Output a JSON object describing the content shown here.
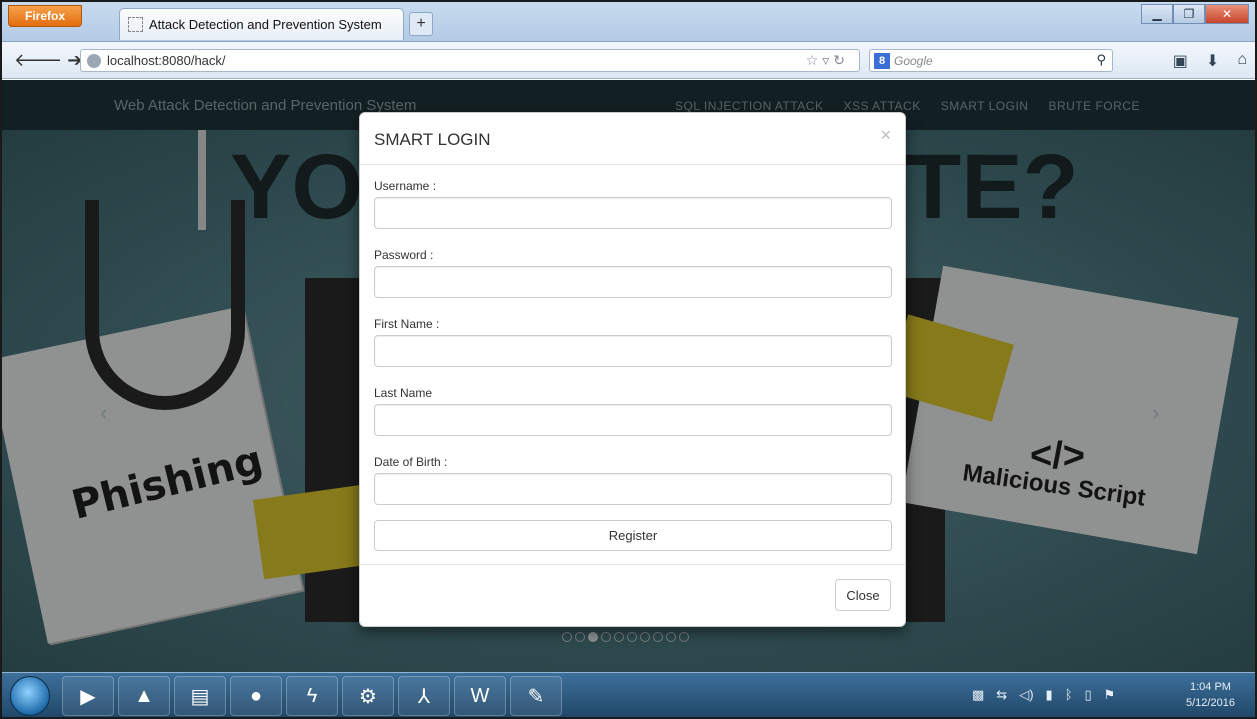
{
  "browser": {
    "firefox_button": "Firefox",
    "tab_title": "Attack Detection and Prevention System",
    "new_tab": "+",
    "url": "localhost:8080/hack/",
    "search_engine": "8",
    "search_placeholder": "Google"
  },
  "site": {
    "brand": "Web Attack Detection and Prevention System",
    "menu": [
      "SQL INJECTION ATTACK",
      "XSS ATTACK",
      "SMART LOGIN",
      "BRUTE FORCE"
    ]
  },
  "hero": {
    "letters_left": "YO",
    "letters_right": "TE?",
    "left_word": "Phishing",
    "right_tag": "</>",
    "right_word": "Malicious Script",
    "slides_total": 10,
    "slide_active": 3
  },
  "modal": {
    "title": "SMART LOGIN",
    "close_x": "×",
    "fields": [
      {
        "label": "Username :",
        "value": ""
      },
      {
        "label": "Password :",
        "value": ""
      },
      {
        "label": "First Name :",
        "value": ""
      },
      {
        "label": "Last Name",
        "value": ""
      },
      {
        "label": "Date of Birth :",
        "value": ""
      }
    ],
    "register_label": "Register",
    "close_label": "Close"
  },
  "taskbar": {
    "time": "1:04 PM",
    "date": "5/12/2016"
  },
  "colors": {
    "site_nav": "#1f3439",
    "hero": "#4f7d84",
    "taskbar": "#1f4667"
  }
}
